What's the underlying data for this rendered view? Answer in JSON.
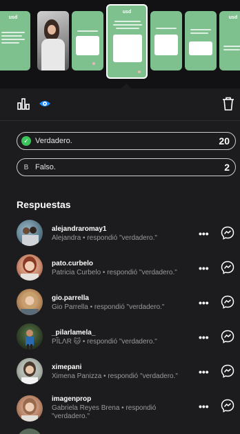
{
  "stories": [
    {
      "kind": "green",
      "logo": "usd"
    },
    {
      "kind": "photo"
    },
    {
      "kind": "green",
      "logo": ""
    },
    {
      "kind": "green-selected",
      "logo": "usd"
    },
    {
      "kind": "green",
      "logo": ""
    },
    {
      "kind": "green",
      "logo": ""
    },
    {
      "kind": "green",
      "logo": "usd"
    }
  ],
  "toolbar": {
    "insights_icon": "bar-chart-icon",
    "viewers_icon": "eye-icon",
    "delete_icon": "trash-icon"
  },
  "poll": {
    "options": [
      {
        "letter": "check",
        "label": "Verdadero.",
        "count": "20",
        "correct": true
      },
      {
        "letter": "B",
        "label": "Falso.",
        "count": "2",
        "correct": false
      }
    ]
  },
  "responses": {
    "title": "Respuestas",
    "items": [
      {
        "username": "alejandraromay1",
        "detail": "Alejandra • respondió \"verdadero.\""
      },
      {
        "username": "pato.curbelo",
        "detail": "Patricia Curbelo • respondió \"verdadero.\""
      },
      {
        "username": "gio.parrella",
        "detail": "Gio Parrella • respondió \"verdadero.\""
      },
      {
        "username": "_pilarlamela_",
        "detail": "PĨLΛR 🐱 • respondió \"verdadero.\""
      },
      {
        "username": "ximepani",
        "detail": "Ximena Panizza • respondió \"verdadero.\""
      },
      {
        "username": "imagenprop",
        "detail": "Gabriela Reyes Brena • respondió \"verdadero.\""
      }
    ],
    "more_label": "•••"
  },
  "colors": {
    "story_green": "#7fc08f",
    "check_green": "#3cc35c",
    "background": "#1c1c1e"
  }
}
